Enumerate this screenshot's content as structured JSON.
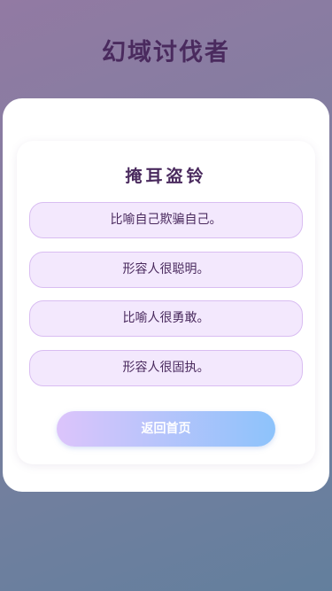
{
  "app": {
    "title": "幻域讨伐者"
  },
  "quiz": {
    "idiom": "掩耳盗铃",
    "options": [
      {
        "label": "比喻自己欺骗自己。"
      },
      {
        "label": "形容人很聪明。"
      },
      {
        "label": "比喻人很勇敢。"
      },
      {
        "label": "形容人很固执。"
      }
    ],
    "home_button_label": "返回首页"
  },
  "colors": {
    "title": "#4a2a5e",
    "option_bg": "#f3e8fd",
    "option_border": "#d9bdf2",
    "button_gradient_start": "#dcc4fb",
    "button_gradient_end": "#8dc3fb"
  }
}
